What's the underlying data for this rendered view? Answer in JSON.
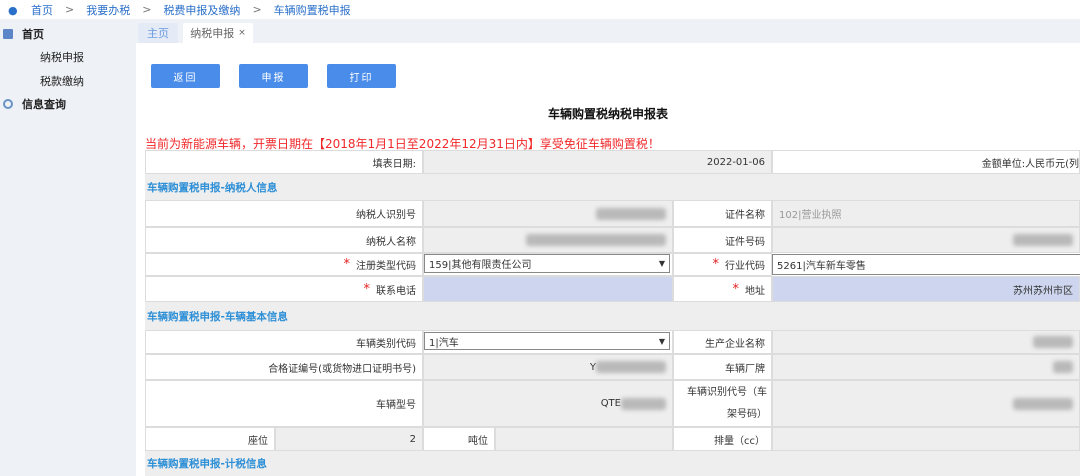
{
  "breadcrumb": [
    "首页",
    "我要办税",
    "税费申报及缴纳",
    "车辆购置税申报"
  ],
  "sidebar": {
    "items": [
      {
        "label": "首页",
        "icon": "grid-icon"
      },
      {
        "label": "纳税申报"
      },
      {
        "label": "税款缴纳"
      },
      {
        "label": "信息查询",
        "icon": "search-icon"
      }
    ]
  },
  "tabs": [
    {
      "label": "主页"
    },
    {
      "label": "纳税申报",
      "close": "×"
    }
  ],
  "toolbar": {
    "back": "返回",
    "submit": "申报",
    "print": "打印"
  },
  "form": {
    "title": "车辆购置税纳税申报表",
    "notice": "当前为新能源车辆，开票日期在【2018年1月1日至2022年12月31日内】享受免征车辆购置税！",
    "fill_date_label": "填表日期:",
    "fill_date": "2022-01-06",
    "unit": "金额单位:人民币元(列",
    "sections": [
      "车辆购置税申报-纳税人信息",
      "车辆购置税申报-车辆基本信息",
      "车辆购置税申报-计税信息"
    ],
    "taxpayer": {
      "id_label": "纳税人识别号",
      "cert_name_label": "证件名称",
      "cert_name": "102|营业执照",
      "name_label": "纳税人名称",
      "cert_no_label": "证件号码",
      "reg_type_label": "注册类型代码",
      "reg_type": "159|其他有限责任公司",
      "industry_label": "行业代码",
      "industry": "5261|汽车新车零售",
      "phone_label": "联系电话",
      "address_label": "地址",
      "address": "苏州苏州市区"
    },
    "vehicle": {
      "type_label": "车辆类别代码",
      "type": "1|汽车",
      "maker_label": "生产企业名称",
      "cert_label": "合格证编号(或货物进口证明书号)",
      "cert_prefix": "Y",
      "brand_label": "车辆厂牌",
      "model_label": "车辆型号",
      "model_prefix": "QTE",
      "vin_label": "车辆识别代号（车架号码）",
      "seats_label": "座位",
      "seats": "2",
      "tonnage_label": "吨位",
      "displacement_label": "排量（cc）"
    }
  },
  "colors": {
    "accent": "#4a8cea",
    "notice": "#f0282a",
    "section": "#2d8fd6"
  }
}
